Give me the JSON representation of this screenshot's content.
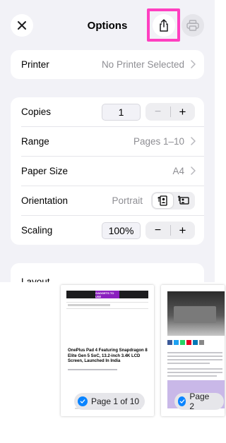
{
  "header": {
    "title": "Options"
  },
  "printer": {
    "label": "Printer",
    "value": "No Printer Selected"
  },
  "settings": {
    "copies": {
      "label": "Copies",
      "value": "1"
    },
    "range": {
      "label": "Range",
      "value": "Pages 1–10"
    },
    "paper_size": {
      "label": "Paper Size",
      "value": "A4"
    },
    "orientation": {
      "label": "Orientation",
      "value": "Portrait"
    },
    "scaling": {
      "label": "Scaling",
      "value": "100%"
    }
  },
  "layout": {
    "label": "Layout"
  },
  "stepper": {
    "minus": "−",
    "plus": "+"
  },
  "preview": {
    "pages": [
      {
        "label": "Page 1 of 10",
        "headline": "OnePlus Pad 4 Featuring Snapdragon 8 Elite Gen 5 SoC, 13.2-inch 3.4K LCD Screen, Launched In India",
        "logo": "GADGETS TO USE"
      },
      {
        "label": "Page 2"
      }
    ]
  },
  "colors": {
    "accent": "#0a84ff",
    "highlight": "#ff3fc0",
    "logo_purple": "#8b1fbf"
  }
}
